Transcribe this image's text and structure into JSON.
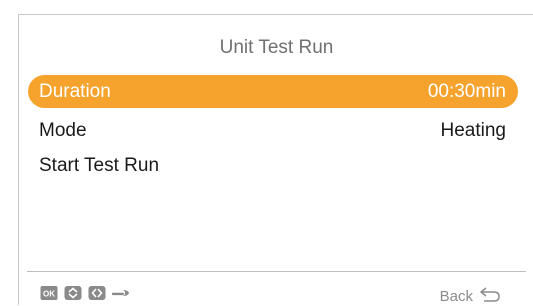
{
  "screen": {
    "title": "Unit Test Run"
  },
  "menu": {
    "items": [
      {
        "label": "Duration",
        "value": "00:30min",
        "selected": true
      },
      {
        "label": "Mode",
        "value": "Heating",
        "selected": false
      },
      {
        "label": "Start Test Run",
        "value": "",
        "selected": false
      }
    ]
  },
  "footer": {
    "icons": [
      "ok-icon",
      "up-down-arrows-icon",
      "left-right-arrows-icon",
      "wrench-icon"
    ],
    "back_label": "Back"
  },
  "colors": {
    "accent": "#f5a32d",
    "text": "#1a1a1a",
    "muted": "#8c8c8c",
    "icon": "#8a8a8a"
  }
}
